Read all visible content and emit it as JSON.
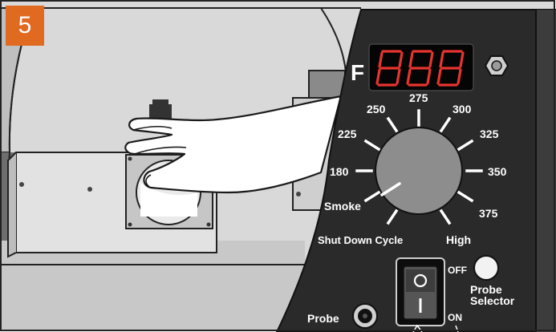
{
  "step": {
    "number": "5"
  },
  "controller": {
    "display": {
      "unit": "F",
      "digits": [
        "8",
        "8",
        "8"
      ]
    },
    "dial": {
      "labels": [
        "275",
        "250",
        "300",
        "225",
        "325",
        "180",
        "350",
        "Smoke",
        "375",
        "Shut Down Cycle",
        "High"
      ]
    },
    "switch": {
      "off_label": "OFF",
      "on_label": "ON"
    },
    "probe_selector": {
      "line1": "Probe",
      "line2": "Selector"
    },
    "probe_jack": {
      "label": "Probe"
    }
  },
  "colors": {
    "badge": "#e16a21",
    "panel": "#2a2a2a",
    "led": "#e8342e",
    "grill": "#dcdcdc"
  }
}
